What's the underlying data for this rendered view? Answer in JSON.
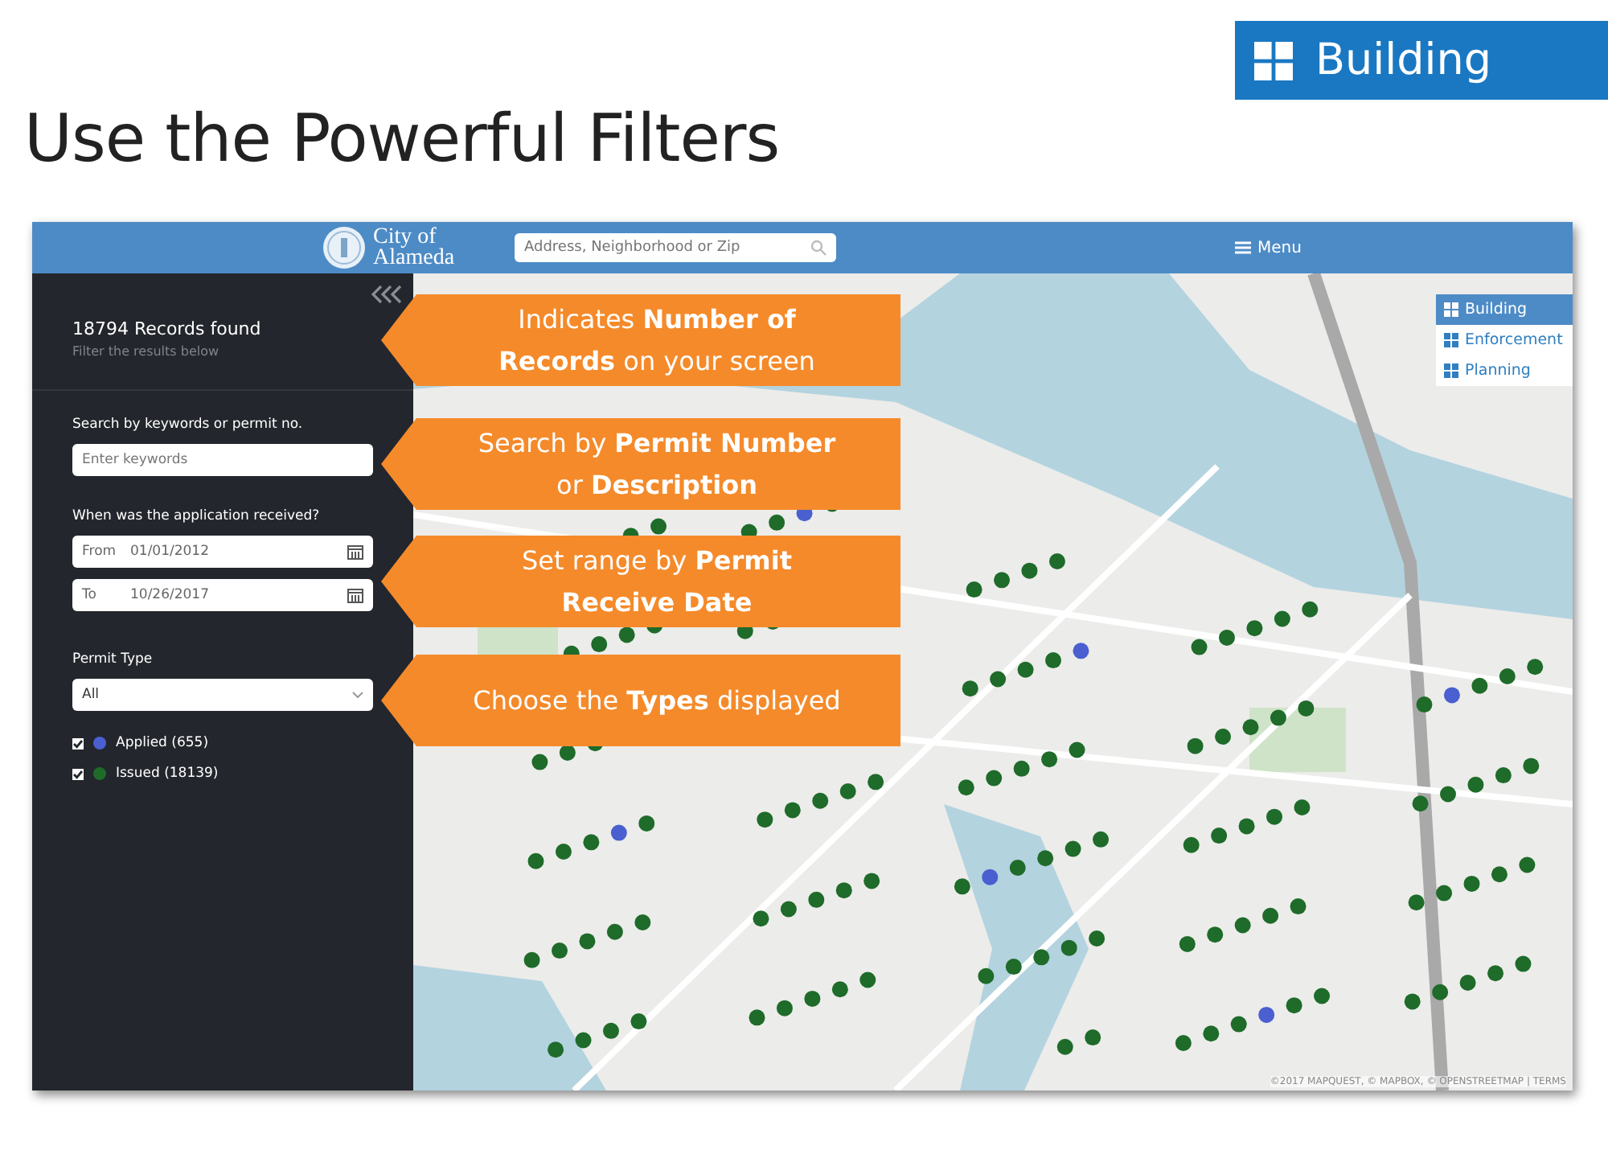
{
  "slide": {
    "badge": "Building",
    "title": "Use the Powerful Filters"
  },
  "app": {
    "logo": "City of Alameda",
    "search_placeholder": "Address, Neighborhood or Zip",
    "menu": "Menu"
  },
  "sidebar": {
    "records": "18794 Records found",
    "hint": "Filter the results below",
    "keyword_label": "Search by keywords or permit no.",
    "keyword_placeholder": "Enter keywords",
    "date_label": "When was the application received?",
    "from_label": "From",
    "from_value": "01/01/2012",
    "to_label": "To",
    "to_value": "10/26/2017",
    "type_label": "Permit Type",
    "type_value": "All",
    "statuses": [
      {
        "label": "Applied (655)",
        "checked": true,
        "color": "#4a5fd0"
      },
      {
        "label": "Issued (18139)",
        "checked": true,
        "color": "#1e6b2a"
      }
    ]
  },
  "layers": [
    {
      "label": "Building",
      "selected": true
    },
    {
      "label": "Enforcement",
      "selected": false
    },
    {
      "label": "Planning",
      "selected": false
    }
  ],
  "callouts": [
    {
      "text": "Indicates **Number of Records** on your screen"
    },
    {
      "text": "Search by **Permit Number** or **Description**"
    },
    {
      "text": "Set range by **Permit Receive Date**"
    },
    {
      "text": "Choose the **Types** displayed"
    }
  ],
  "attribution": "©2017 MAPQUEST, © MAPBOX, © OPENSTREETMAP | TERMS"
}
